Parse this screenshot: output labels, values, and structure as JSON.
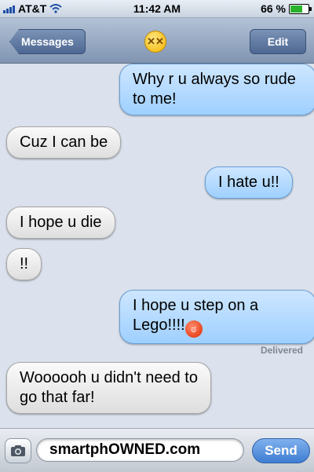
{
  "status_bar": {
    "carrier": "AT&T",
    "time": "11:42 AM",
    "battery_text": "66 %",
    "battery_level": 0.66,
    "signal_bars": 4
  },
  "nav": {
    "back_label": "Messages",
    "edit_label": "Edit",
    "contact_icon": "dizzy-face-icon"
  },
  "messages": [
    {
      "direction": "out",
      "text": "Why r u always so rude to me!"
    },
    {
      "direction": "in",
      "text": "Cuz I can be"
    },
    {
      "direction": "out",
      "text": "I hate u!!"
    },
    {
      "direction": "in",
      "text": "I hope u die"
    },
    {
      "direction": "in",
      "text": "!!"
    },
    {
      "direction": "out",
      "text": "I hope u step on a Lego!!!!",
      "emoji": "angry-face-icon"
    },
    {
      "direction": "in",
      "text": "Woooooh u didn't need to go that far!"
    }
  ],
  "delivered_label": "Delivered",
  "input": {
    "text": "smartphOWNED.com",
    "send_label": "Send",
    "camera_icon": "camera-icon"
  },
  "colors": {
    "outgoing_bubble": "#a9d5ff",
    "incoming_bubble": "#e8e8e8",
    "background": "#dbe2ed",
    "nav_bar": "#8a9dba",
    "send_button": "#4f8ad8"
  }
}
